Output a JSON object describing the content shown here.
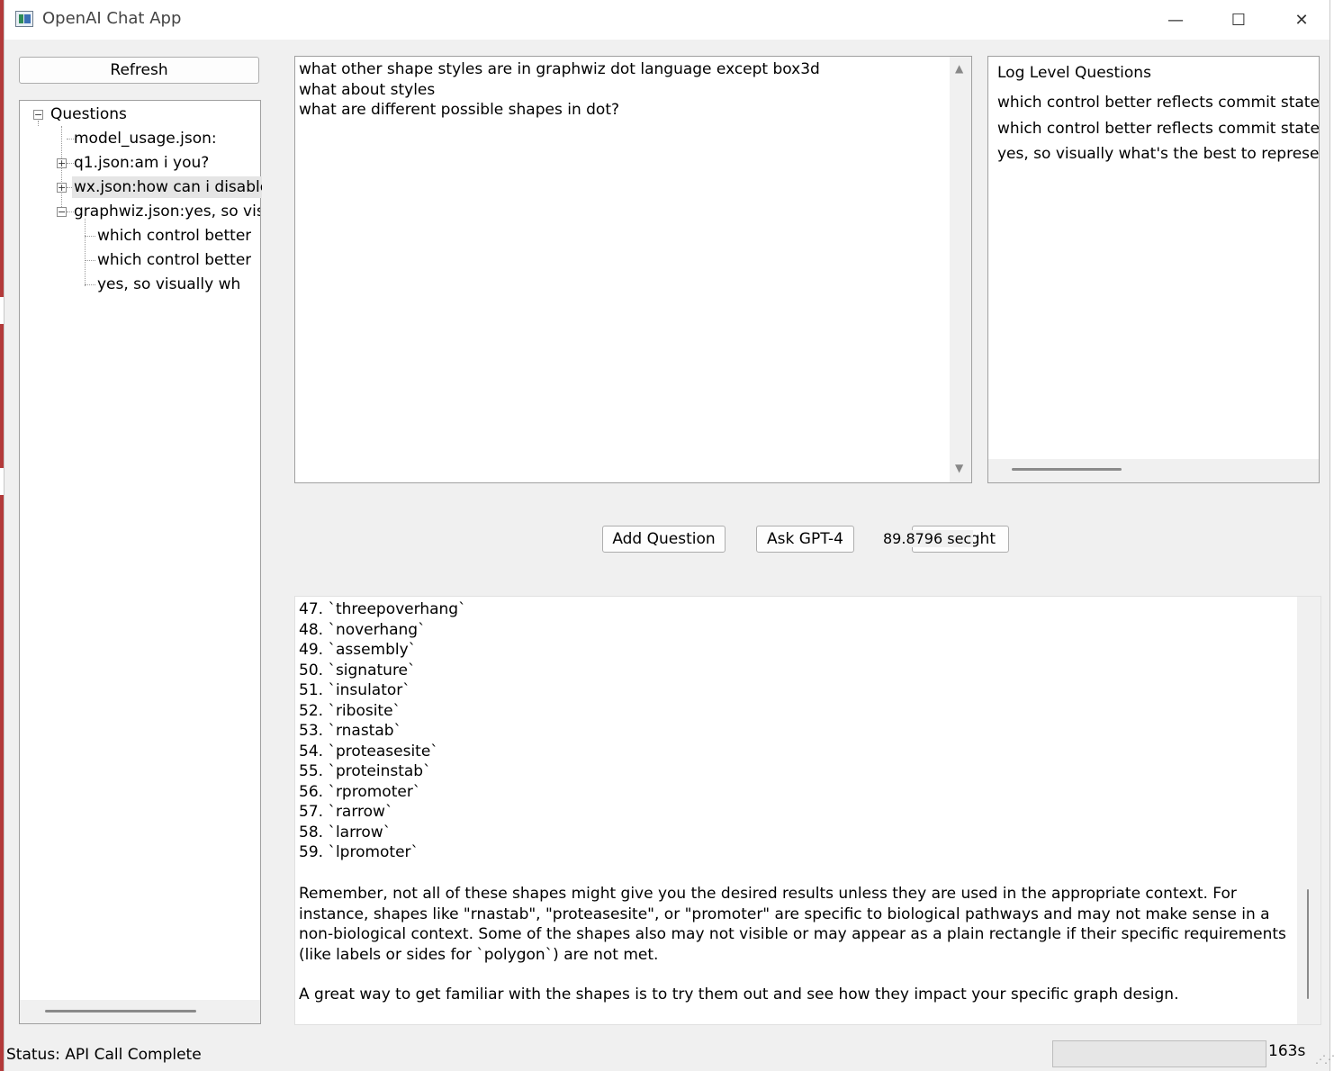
{
  "window": {
    "title": "OpenAI Chat App",
    "minimize_label": "—",
    "maximize_label": "☐",
    "close_label": "✕"
  },
  "sidebar": {
    "refresh_label": "Refresh",
    "tree": {
      "root": "Questions",
      "expanded_root": "−",
      "items": [
        {
          "label": "model_usage.json:",
          "toggle": ""
        },
        {
          "label": "q1.json:am i you?",
          "toggle": "+"
        },
        {
          "label": "wx.json:how can i disable",
          "toggle": "+"
        },
        {
          "label": "graphwiz.json:yes, so visua",
          "toggle": "−"
        }
      ],
      "children": [
        "which control better",
        "which control better",
        "yes, so visually wh"
      ]
    }
  },
  "question_editor": {
    "lines": [
      "what other shape styles are in graphwiz dot language except box3d",
      "what about styles",
      "what are different possible shapes in dot?"
    ]
  },
  "log_panel": {
    "title": "Log Level Questions",
    "items": [
      "which control better reflects commit stateme",
      "which control better reflects commit stateme",
      "yes, so visually what's the best to represent co"
    ]
  },
  "actions": {
    "add_question_label": "Add Question",
    "ask_label": "Ask GPT-4",
    "timer_text": "89.8796 sec",
    "light_label": "light"
  },
  "answer": {
    "list": [
      "47. `threepoverhang`",
      "48. `noverhang`",
      "49. `assembly`",
      "50. `signature`",
      "51. `insulator`",
      "52. `ribosite`",
      "53. `rnastab`",
      "54. `proteasesite`",
      "55. `proteinstab`",
      "56. `rpromoter`",
      "57. `rarrow`",
      "58. `larrow`",
      "59. `lpromoter`"
    ],
    "paragraph1": "Remember, not all of these shapes might give you the desired results unless they are used in the appropriate context. For instance, shapes like \"rnastab\", \"proteasesite\", or \"promoter\" are specific to biological pathways and may not make sense in a non-biological context. Some of the shapes also may not visible or may appear as a plain rectangle if their specific requirements (like labels or sides for `polygon`) are not met.",
    "paragraph2": "A great way to get familiar with the shapes is to try them out and see how they impact your specific graph design."
  },
  "status": {
    "text": "Status: API Call Complete",
    "elapsed": "163s"
  },
  "colors": {
    "window_bg": "#f0f0f0",
    "panel_bg": "#ffffff",
    "border": "#a0a0a0"
  }
}
